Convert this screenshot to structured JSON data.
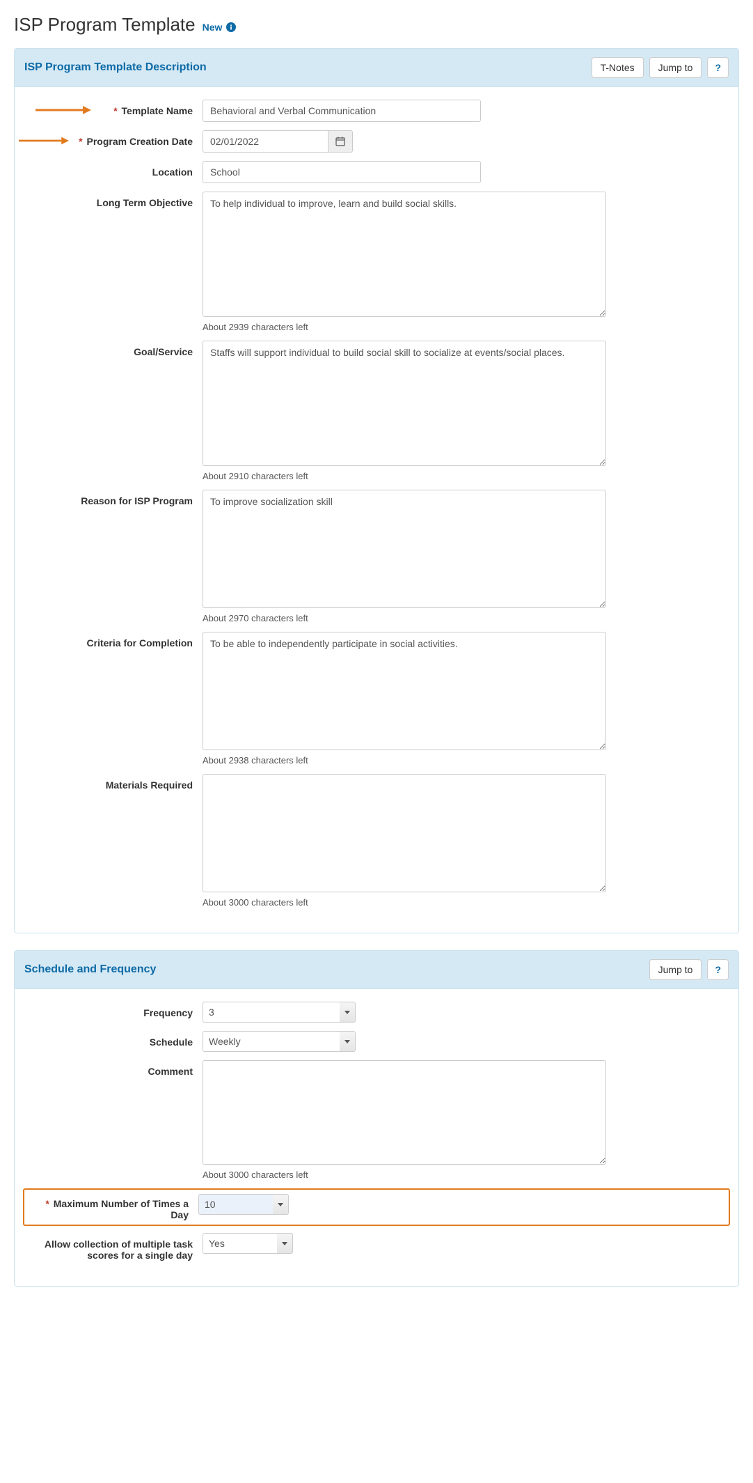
{
  "page": {
    "title": "ISP Program Template",
    "new_badge": "New"
  },
  "section_desc": {
    "title": "ISP Program Template Description",
    "actions": {
      "tnotes": "T-Notes",
      "jumpto": "Jump to",
      "help": "?"
    },
    "fields": {
      "template_name": {
        "label": "Template Name",
        "value": "Behavioral and Verbal Communication"
      },
      "program_creation_date": {
        "label": "Program Creation Date",
        "value": "02/01/2022"
      },
      "location": {
        "label": "Location",
        "value": "School"
      },
      "long_term_objective": {
        "label": "Long Term Objective",
        "value": "To help individual to improve, learn and build social skills.",
        "chars_left": "About 2939 characters left"
      },
      "goal_service": {
        "label": "Goal/Service",
        "value": "Staffs will support individual to build social skill to socialize at events/social places.",
        "chars_left": "About 2910 characters left"
      },
      "reason": {
        "label": "Reason for ISP Program",
        "value": "To improve socialization skill",
        "chars_left": "About 2970 characters left"
      },
      "criteria": {
        "label": "Criteria for Completion",
        "value": "To be able to independently participate in social activities.",
        "chars_left": "About 2938 characters left"
      },
      "materials": {
        "label": "Materials Required",
        "value": "",
        "chars_left": "About 3000 characters left"
      }
    }
  },
  "section_sched": {
    "title": "Schedule and Frequency",
    "actions": {
      "jumpto": "Jump to",
      "help": "?"
    },
    "fields": {
      "frequency": {
        "label": "Frequency",
        "value": "3"
      },
      "schedule": {
        "label": "Schedule",
        "value": "Weekly"
      },
      "comment": {
        "label": "Comment",
        "value": "",
        "chars_left": "About 3000 characters left"
      },
      "max_times": {
        "label": "Maximum Number of Times a Day",
        "value": "10"
      },
      "allow_multi": {
        "label": "Allow collection of multiple task scores for a single day",
        "value": "Yes"
      }
    }
  }
}
